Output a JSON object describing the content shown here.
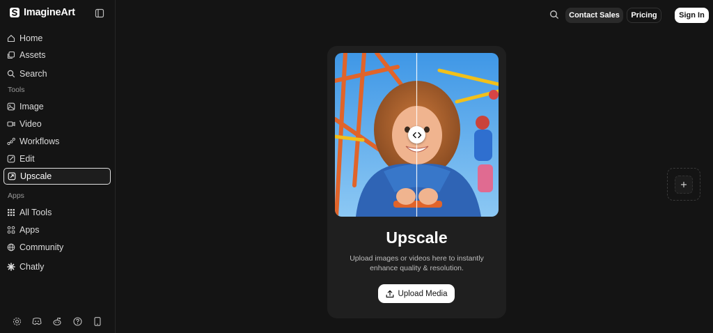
{
  "brand": {
    "name": "ImagineArt",
    "logo_icon": "imagineart-logo-icon"
  },
  "sidebar": {
    "top_items": [
      {
        "label": "Home",
        "icon": "home-icon"
      },
      {
        "label": "Assets",
        "icon": "assets-icon"
      },
      {
        "label": "Search",
        "icon": "search-icon"
      }
    ],
    "tools_label": "Tools",
    "tools": [
      {
        "label": "Image",
        "icon": "image-icon"
      },
      {
        "label": "Video",
        "icon": "video-icon"
      },
      {
        "label": "Workflows",
        "icon": "workflows-icon"
      },
      {
        "label": "Edit",
        "icon": "edit-icon"
      },
      {
        "label": "Upscale",
        "icon": "upscale-icon",
        "active": true
      }
    ],
    "apps_label": "Apps",
    "apps": [
      {
        "label": "All Tools",
        "icon": "grid-icon"
      },
      {
        "label": "Apps",
        "icon": "apps-icon"
      },
      {
        "label": "Community",
        "icon": "globe-icon"
      },
      {
        "label": "Chatly",
        "icon": "chatly-icon"
      }
    ],
    "bottom_icons": [
      "settings-icon",
      "discord-icon",
      "reddit-icon",
      "help-icon",
      "mobile-icon"
    ]
  },
  "header": {
    "contact_label": "Contact Sales",
    "pricing_label": "Pricing",
    "signin_label": "Sign In"
  },
  "card": {
    "title": "Upscale",
    "description": "Upload images or videos here to instantly enhance quality & resolution.",
    "upload_label": "Upload Media"
  },
  "colors": {
    "background": "#141414",
    "card": "#1f1f1f",
    "accent_white": "#ffffff"
  }
}
